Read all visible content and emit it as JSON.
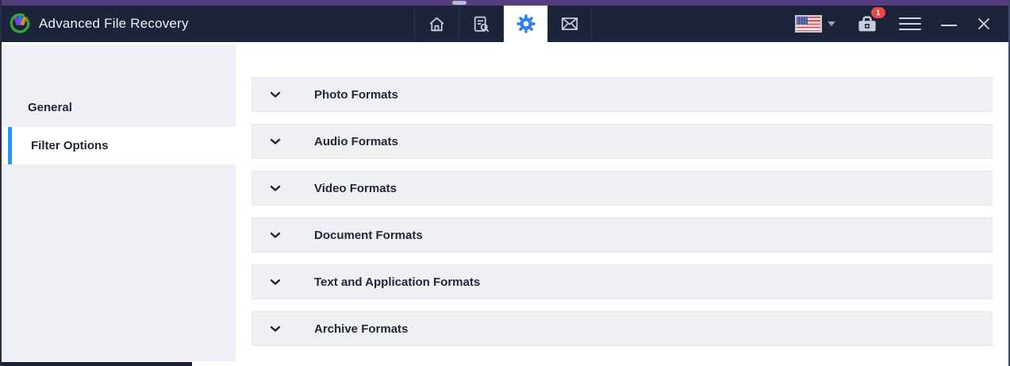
{
  "titlebar": {
    "app_title": "Advanced File Recovery",
    "nav_tabs": [
      {
        "id": "home",
        "icon": "home-icon",
        "active": false
      },
      {
        "id": "file-search",
        "icon": "file-search-icon",
        "active": false
      },
      {
        "id": "settings",
        "icon": "gear-icon",
        "active": true
      },
      {
        "id": "contact",
        "icon": "mail-icon",
        "active": false
      }
    ],
    "language_selector": {
      "flag": "us-flag-icon"
    },
    "toolbox_badge_count": "1"
  },
  "sidebar": {
    "items": [
      {
        "label": "General",
        "active": false
      },
      {
        "label": "Filter Options",
        "active": true
      }
    ]
  },
  "content": {
    "sections": [
      {
        "label": "Photo Formats",
        "state": "collapsed"
      },
      {
        "label": "Audio Formats",
        "state": "collapsed"
      },
      {
        "label": "Video Formats",
        "state": "collapsed"
      },
      {
        "label": "Document Formats",
        "state": "collapsed"
      },
      {
        "label": "Text and Application Formats",
        "state": "collapsed"
      },
      {
        "label": "Archive Formats",
        "state": "collapsed"
      }
    ]
  },
  "colors": {
    "titlebar_bg": "#1b2438",
    "top_strip_purple": "#573c7e",
    "accent_blue_gear": "#2e7df5",
    "selected_item_bar": "#2196f3",
    "badge_red": "#e8474e",
    "sidebar_bg": "#eef0f5",
    "section_row_bg": "#eef0f4",
    "icon_gray": "#c9cede",
    "text_dark": "#1f2633"
  }
}
